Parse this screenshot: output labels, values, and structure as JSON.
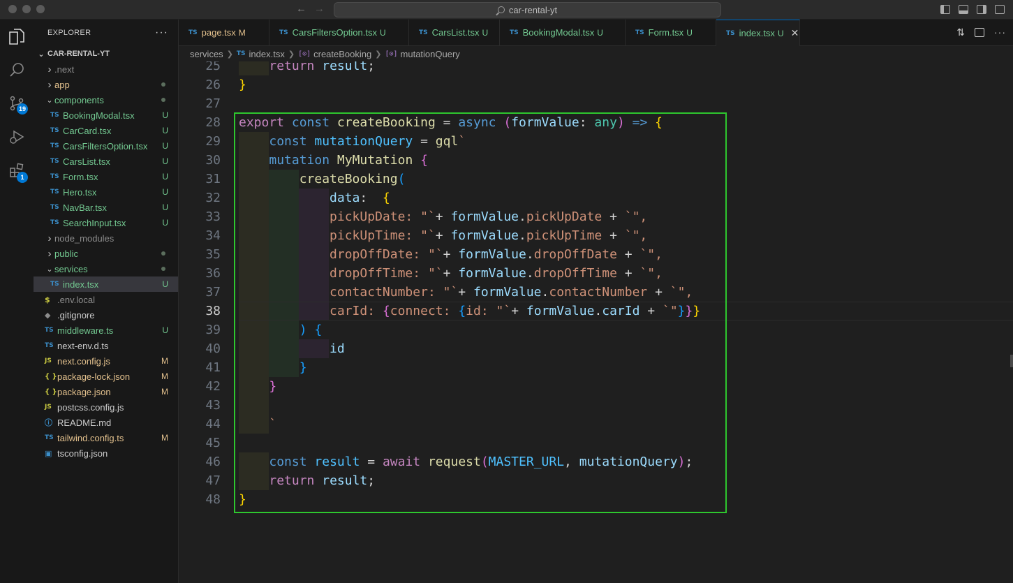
{
  "window": {
    "title": "car-rental-yt"
  },
  "activity": {
    "scm_badge": "19",
    "extensions_badge": "1"
  },
  "sidebar": {
    "header": "EXPLORER",
    "more": "···",
    "root": "CAR-RENTAL-YT",
    "items": [
      {
        "name": ".next",
        "kind": "folder",
        "open": false,
        "depth": 1,
        "color": "dim"
      },
      {
        "name": "app",
        "kind": "folder",
        "open": false,
        "depth": 1,
        "color": "mod",
        "dot": true
      },
      {
        "name": "components",
        "kind": "folder",
        "open": true,
        "depth": 1,
        "color": "green",
        "dot": true
      },
      {
        "name": "BookingModal.tsx",
        "kind": "ts",
        "depth": 2,
        "color": "green",
        "status": "U"
      },
      {
        "name": "CarCard.tsx",
        "kind": "ts",
        "depth": 2,
        "color": "green",
        "status": "U"
      },
      {
        "name": "CarsFiltersOption.tsx",
        "kind": "ts",
        "depth": 2,
        "color": "green",
        "status": "U"
      },
      {
        "name": "CarsList.tsx",
        "kind": "ts",
        "depth": 2,
        "color": "green",
        "status": "U"
      },
      {
        "name": "Form.tsx",
        "kind": "ts",
        "depth": 2,
        "color": "green",
        "status": "U"
      },
      {
        "name": "Hero.tsx",
        "kind": "ts",
        "depth": 2,
        "color": "green",
        "status": "U"
      },
      {
        "name": "NavBar.tsx",
        "kind": "ts",
        "depth": 2,
        "color": "green",
        "status": "U"
      },
      {
        "name": "SearchInput.tsx",
        "kind": "ts",
        "depth": 2,
        "color": "green",
        "status": "U"
      },
      {
        "name": "node_modules",
        "kind": "folder",
        "open": false,
        "depth": 1,
        "color": "dim"
      },
      {
        "name": "public",
        "kind": "folder",
        "open": false,
        "depth": 1,
        "color": "green",
        "dot": true
      },
      {
        "name": "services",
        "kind": "folder",
        "open": true,
        "depth": 1,
        "color": "green",
        "dot": true
      },
      {
        "name": "index.tsx",
        "kind": "ts",
        "depth": 2,
        "color": "green",
        "status": "U",
        "selected": true
      },
      {
        "name": ".env.local",
        "kind": "env",
        "depth": 1,
        "color": "dim"
      },
      {
        "name": ".gitignore",
        "kind": "git",
        "depth": 1,
        "color": "plain"
      },
      {
        "name": "middleware.ts",
        "kind": "ts",
        "depth": 1,
        "color": "green",
        "status": "U"
      },
      {
        "name": "next-env.d.ts",
        "kind": "ts",
        "depth": 1,
        "color": "plain"
      },
      {
        "name": "next.config.js",
        "kind": "js",
        "depth": 1,
        "color": "mod",
        "status": "M"
      },
      {
        "name": "package-lock.json",
        "kind": "json",
        "depth": 1,
        "color": "mod",
        "status": "M"
      },
      {
        "name": "package.json",
        "kind": "json",
        "depth": 1,
        "color": "mod",
        "status": "M"
      },
      {
        "name": "postcss.config.js",
        "kind": "js",
        "depth": 1,
        "color": "plain"
      },
      {
        "name": "README.md",
        "kind": "info",
        "depth": 1,
        "color": "plain"
      },
      {
        "name": "tailwind.config.ts",
        "kind": "ts",
        "depth": 1,
        "color": "mod",
        "status": "M"
      },
      {
        "name": "tsconfig.json",
        "kind": "tsconfig",
        "depth": 1,
        "color": "plain"
      }
    ]
  },
  "tabs": [
    {
      "label": "page.tsx",
      "status": "M",
      "color": "mod"
    },
    {
      "label": "CarsFiltersOption.tsx",
      "status": "U",
      "color": "green"
    },
    {
      "label": "CarsList.tsx",
      "status": "U",
      "color": "green"
    },
    {
      "label": "BookingModal.tsx",
      "status": "U",
      "color": "green"
    },
    {
      "label": "Form.tsx",
      "status": "U",
      "color": "green"
    },
    {
      "label": "index.tsx",
      "status": "U",
      "color": "green",
      "active": true
    }
  ],
  "breadcrumb": {
    "folder": "services",
    "file": "index.tsx",
    "fn": "createBooking",
    "var": "mutationQuery"
  },
  "editor": {
    "current_line": 38,
    "lines": [
      {
        "n": 25,
        "g": 1,
        "t": [
          [
            "    ",
            ""
          ],
          [
            "return",
            "kw2"
          ],
          [
            " ",
            ""
          ],
          [
            "result",
            "vr"
          ],
          [
            ";",
            "op"
          ]
        ]
      },
      {
        "n": 26,
        "g": 0,
        "t": [
          [
            "}",
            "pr1"
          ]
        ]
      },
      {
        "n": 27,
        "g": 0,
        "t": []
      },
      {
        "n": 28,
        "g": 0,
        "t": [
          [
            "export",
            "kw2"
          ],
          [
            " ",
            ""
          ],
          [
            "const",
            "kw"
          ],
          [
            " ",
            ""
          ],
          [
            "createBooking",
            "fn"
          ],
          [
            " = ",
            "op"
          ],
          [
            "async",
            "kw"
          ],
          [
            " ",
            ""
          ],
          [
            "(",
            "pr2"
          ],
          [
            "formValue",
            "vr"
          ],
          [
            ": ",
            "op"
          ],
          [
            "any",
            "ty"
          ],
          [
            ")",
            "pr2"
          ],
          [
            " ",
            ""
          ],
          [
            "=>",
            "kw"
          ],
          [
            " ",
            ""
          ],
          [
            "{",
            "pr1"
          ]
        ]
      },
      {
        "n": 29,
        "g": 1,
        "t": [
          [
            "    ",
            ""
          ],
          [
            "const",
            "kw"
          ],
          [
            " ",
            ""
          ],
          [
            "mutationQuery",
            "cn"
          ],
          [
            " = ",
            "op"
          ],
          [
            "gql",
            "fn"
          ],
          [
            "`",
            "str"
          ]
        ]
      },
      {
        "n": 30,
        "g": 1,
        "t": [
          [
            "    ",
            ""
          ],
          [
            "mutation",
            "kw"
          ],
          [
            " ",
            ""
          ],
          [
            "MyMutation",
            "fn"
          ],
          [
            " ",
            ""
          ],
          [
            "{",
            "pr2"
          ]
        ]
      },
      {
        "n": 31,
        "g": 2,
        "t": [
          [
            "        ",
            ""
          ],
          [
            "createBooking",
            "fn"
          ],
          [
            "(",
            "pr3"
          ]
        ]
      },
      {
        "n": 32,
        "g": 3,
        "t": [
          [
            "            ",
            ""
          ],
          [
            "data",
            "vr"
          ],
          [
            ":  ",
            "op"
          ],
          [
            "{",
            "pr1"
          ]
        ]
      },
      {
        "n": 33,
        "g": 3,
        "t": [
          [
            "            ",
            ""
          ],
          [
            "pickUpDate",
            "str"
          ],
          [
            ": \"`",
            "str"
          ],
          [
            "+ ",
            "op"
          ],
          [
            "formValue",
            "vr"
          ],
          [
            ".",
            "op"
          ],
          [
            "pickUpDate",
            "str"
          ],
          [
            " + ",
            "op"
          ],
          [
            "`\",",
            "str"
          ]
        ]
      },
      {
        "n": 34,
        "g": 3,
        "t": [
          [
            "            ",
            ""
          ],
          [
            "pickUpTime",
            "str"
          ],
          [
            ": \"`",
            "str"
          ],
          [
            "+ ",
            "op"
          ],
          [
            "formValue",
            "vr"
          ],
          [
            ".",
            "op"
          ],
          [
            "pickUpTime",
            "str"
          ],
          [
            " + ",
            "op"
          ],
          [
            "`\",",
            "str"
          ]
        ]
      },
      {
        "n": 35,
        "g": 3,
        "t": [
          [
            "            ",
            ""
          ],
          [
            "dropOffDate",
            "str"
          ],
          [
            ": \"`",
            "str"
          ],
          [
            "+ ",
            "op"
          ],
          [
            "formValue",
            "vr"
          ],
          [
            ".",
            "op"
          ],
          [
            "dropOffDate",
            "str"
          ],
          [
            " + ",
            "op"
          ],
          [
            "`\",",
            "str"
          ]
        ]
      },
      {
        "n": 36,
        "g": 3,
        "t": [
          [
            "            ",
            ""
          ],
          [
            "dropOffTime",
            "str"
          ],
          [
            ": \"`",
            "str"
          ],
          [
            "+ ",
            "op"
          ],
          [
            "formValue",
            "vr"
          ],
          [
            ".",
            "op"
          ],
          [
            "dropOffTime",
            "str"
          ],
          [
            " + ",
            "op"
          ],
          [
            "`\",",
            "str"
          ]
        ]
      },
      {
        "n": 37,
        "g": 3,
        "t": [
          [
            "            ",
            ""
          ],
          [
            "contactNumber",
            "str"
          ],
          [
            ": \"`",
            "str"
          ],
          [
            "+ ",
            "op"
          ],
          [
            "formValue",
            "vr"
          ],
          [
            ".",
            "op"
          ],
          [
            "contactNumber",
            "str"
          ],
          [
            " + ",
            "op"
          ],
          [
            "`\",",
            "str"
          ]
        ]
      },
      {
        "n": 38,
        "g": 3,
        "t": [
          [
            "            ",
            ""
          ],
          [
            "carId",
            "str"
          ],
          [
            ": ",
            "str"
          ],
          [
            "{",
            "pr2"
          ],
          [
            "connect",
            "str"
          ],
          [
            ": ",
            "str"
          ],
          [
            "{",
            "pr3"
          ],
          [
            "id",
            "str"
          ],
          [
            ": \"`",
            "str"
          ],
          [
            "+ ",
            "op"
          ],
          [
            "formValue",
            "vr"
          ],
          [
            ".",
            "op"
          ],
          [
            "carId",
            "vr"
          ],
          [
            " + ",
            "op"
          ],
          [
            "`\"",
            "str"
          ],
          [
            "}",
            "pr3"
          ],
          [
            "}",
            "pr2"
          ],
          [
            "}",
            "pr1"
          ]
        ]
      },
      {
        "n": 39,
        "g": 2,
        "t": [
          [
            "        ",
            ""
          ],
          [
            ")",
            "pr3"
          ],
          [
            " ",
            ""
          ],
          [
            "{",
            "pr3"
          ]
        ]
      },
      {
        "n": 40,
        "g": 3,
        "t": [
          [
            "            ",
            ""
          ],
          [
            "id",
            "vr"
          ]
        ]
      },
      {
        "n": 41,
        "g": 2,
        "t": [
          [
            "        ",
            ""
          ],
          [
            "}",
            "pr3"
          ]
        ]
      },
      {
        "n": 42,
        "g": 1,
        "t": [
          [
            "    ",
            ""
          ],
          [
            "}",
            "pr2"
          ]
        ]
      },
      {
        "n": 43,
        "g": 1,
        "t": []
      },
      {
        "n": 44,
        "g": 1,
        "t": [
          [
            "    ",
            ""
          ],
          [
            "`",
            "str"
          ]
        ]
      },
      {
        "n": 45,
        "g": 0,
        "t": []
      },
      {
        "n": 46,
        "g": 1,
        "t": [
          [
            "    ",
            ""
          ],
          [
            "const",
            "kw"
          ],
          [
            " ",
            ""
          ],
          [
            "result",
            "cn"
          ],
          [
            " = ",
            "op"
          ],
          [
            "await",
            "kw2"
          ],
          [
            " ",
            ""
          ],
          [
            "request",
            "fn"
          ],
          [
            "(",
            "pr2"
          ],
          [
            "MASTER_URL",
            "cn"
          ],
          [
            ", ",
            "op"
          ],
          [
            "mutationQuery",
            "vr"
          ],
          [
            ")",
            "pr2"
          ],
          [
            ";",
            "op"
          ]
        ]
      },
      {
        "n": 47,
        "g": 1,
        "t": [
          [
            "    ",
            ""
          ],
          [
            "return",
            "kw2"
          ],
          [
            " ",
            ""
          ],
          [
            "result",
            "vr"
          ],
          [
            ";",
            "op"
          ]
        ]
      },
      {
        "n": 48,
        "g": 0,
        "t": [
          [
            "}",
            "pr1"
          ]
        ]
      }
    ]
  }
}
